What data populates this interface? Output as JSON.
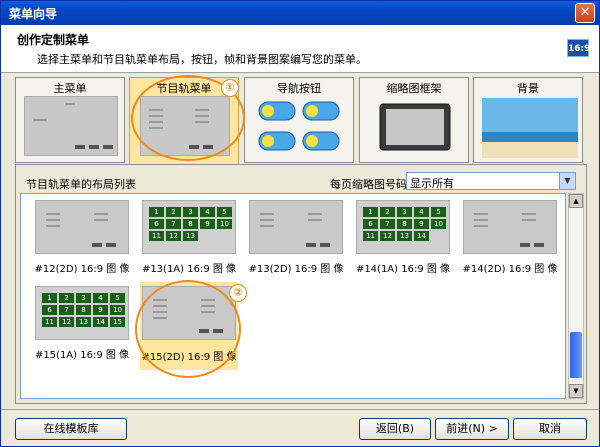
{
  "window": {
    "title": "菜单向导",
    "close_glyph": "✕"
  },
  "header": {
    "title": "创作定制菜单",
    "subtitle": "选择主菜单和节目轨菜单布局，按钮，帧和背景图案编写您的菜单。",
    "ratio_badge": "16:9"
  },
  "tabs": [
    {
      "label": "主菜单",
      "icon": "menu-thumbnail"
    },
    {
      "label": "节目轨菜单",
      "icon": "track-menu-thumbnail"
    },
    {
      "label": "导航按钮",
      "icon": "nav-buttons"
    },
    {
      "label": "缩略图框架",
      "icon": "tv-frame"
    },
    {
      "label": "背景",
      "icon": "beach-background"
    }
  ],
  "annotations": {
    "one": "①",
    "two": "②"
  },
  "layout_list": {
    "label": "节目轨菜单的布局列表",
    "per_page_label": "每页缩略图号码:",
    "per_page_value": "显示所有",
    "items": [
      {
        "caption": "#12(2D) 16:9 图 像",
        "kind": "text",
        "nums": []
      },
      {
        "caption": "#13(1A) 16:9 图 像",
        "kind": "grid",
        "cols": 5,
        "nums": [
          "1",
          "2",
          "3",
          "4",
          "5",
          "6",
          "7",
          "8",
          "9",
          "10",
          "11",
          "12",
          "13"
        ]
      },
      {
        "caption": "#13(2D) 16:9 图 像",
        "kind": "text",
        "nums": []
      },
      {
        "caption": "#14(1A) 16:9 图 像",
        "kind": "grid",
        "cols": 5,
        "nums": [
          "1",
          "2",
          "3",
          "4",
          "5",
          "6",
          "7",
          "8",
          "9",
          "10",
          "11",
          "12",
          "13",
          "14"
        ]
      },
      {
        "caption": "#14(2D) 16:9 图 像",
        "kind": "text",
        "nums": []
      },
      {
        "caption": "#15(1A) 16:9 图 像",
        "kind": "grid",
        "cols": 5,
        "nums": [
          "1",
          "2",
          "3",
          "4",
          "5",
          "6",
          "7",
          "8",
          "9",
          "10",
          "11",
          "12",
          "13",
          "14",
          "15"
        ]
      },
      {
        "caption": "#15(2D) 16:9 图 像",
        "kind": "text",
        "nums": [],
        "selected": true
      }
    ]
  },
  "buttons": {
    "online": "在线模板库",
    "back": "返回(B)",
    "next": "前进(N) >",
    "cancel": "取消"
  },
  "colors": {
    "title_bar": "#0a5fe0",
    "selected": "#ffe6a0",
    "annotation": "#f08a1a",
    "grid_cell": "#1a5e1a"
  }
}
